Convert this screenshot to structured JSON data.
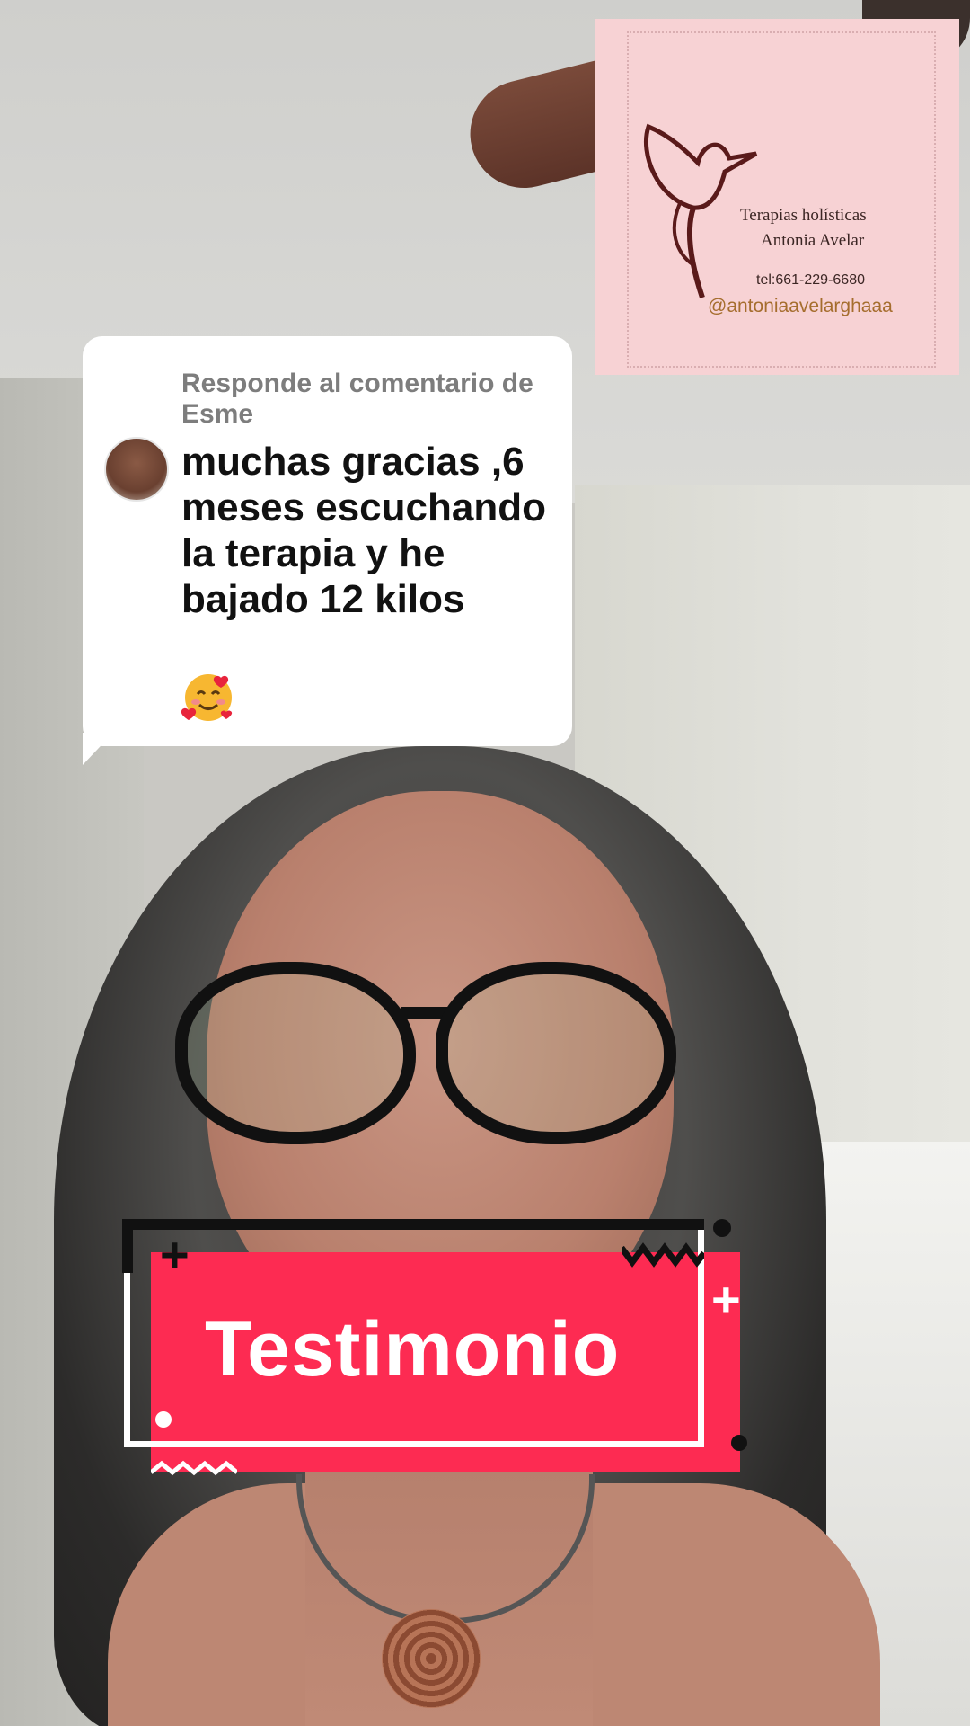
{
  "comment": {
    "reply_label": "Responde al comentario de Esme",
    "text": "muchas gracias ,6 meses escuchando la terapia y he bajado 12 kilos",
    "emoji": "smiling-face-with-hearts"
  },
  "logo": {
    "title": "Terapias holísticas",
    "name": "Antonia Avelar",
    "phone": "tel:661-229-6680",
    "handle": "@antoniaavelarghaaa"
  },
  "sticker": {
    "label": "Testimonio"
  },
  "colors": {
    "sticker_red": "#fd2b52",
    "logo_bg": "#f7d2d4",
    "handle_gold": "#a56d2d"
  }
}
